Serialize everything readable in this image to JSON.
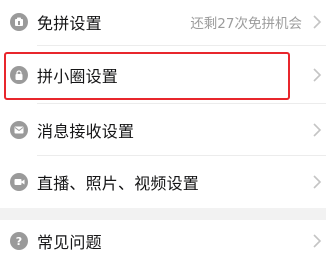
{
  "settings": {
    "items": [
      {
        "label": "免拼设置",
        "hint": "还剩27次免拼机会",
        "icon": "free-group-icon"
      },
      {
        "label": "拼小圈设置",
        "hint": "",
        "icon": "lock-bag-icon"
      },
      {
        "label": "消息接收设置",
        "hint": "",
        "icon": "mail-icon"
      },
      {
        "label": "直播、照片、视频设置",
        "hint": "",
        "icon": "video-camera-icon"
      }
    ],
    "help": {
      "label": "常见问题",
      "icon": "question-icon"
    }
  },
  "colors": {
    "highlight": "#e8262c",
    "icon_gray": "#9a9a9a",
    "hint_gray": "#9c9c9c"
  }
}
